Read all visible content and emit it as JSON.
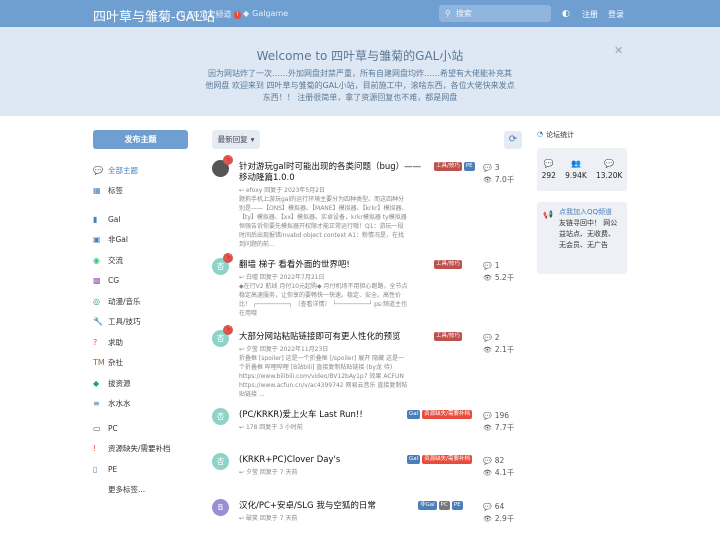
{
  "header": {
    "brand": "四叶草与雏菊-GAL站",
    "nav_tg": "TG定定频道",
    "nav_tg_badge": "!",
    "nav_galgame": "Galgame",
    "search_placeholder": "搜索",
    "register": "注册",
    "login": "登录"
  },
  "hero": {
    "title": "Welcome to 四叶草与雏菊的GAL小站",
    "text": "因为网站炸了一次……外加网盘封禁严重，所有自建网盘均炸……希望有大佬能补充其他网盘 欢迎来到 四叶草与雏菊的GAL小站，目前施工中，滚啥东西，各位大佬快来发点东西！！ 注册很简单，拿了资源回复也不难，都是网盘"
  },
  "sidebar": {
    "post_button": "发布主题",
    "items": [
      {
        "label": "全部主题",
        "icon": "💬",
        "color": "#4a7fb9"
      },
      {
        "label": "标签",
        "icon": "▦",
        "color": "#4a7fb9"
      },
      {
        "label": "Gal",
        "icon": "▮",
        "color": "#4a7fb9"
      },
      {
        "label": "非Gal",
        "icon": "▣",
        "color": "#4a7fb9"
      },
      {
        "label": "交流",
        "icon": "◉",
        "color": "#2ecc71"
      },
      {
        "label": "CG",
        "icon": "▩",
        "color": "#9b59b6"
      },
      {
        "label": "动漫/音乐",
        "icon": "◎",
        "color": "#16a085"
      },
      {
        "label": "工具/技巧",
        "icon": "🔧",
        "color": "#e74c3c"
      },
      {
        "label": "求助",
        "icon": "?",
        "color": "#e74c3c"
      },
      {
        "label": "杂社",
        "icon": "TM",
        "color": "#8a6d3b"
      },
      {
        "label": "拔资源",
        "icon": "◆",
        "color": "#16a085"
      },
      {
        "label": "水水水",
        "icon": "≡",
        "color": "#4a7fb9"
      },
      {
        "label": "PC",
        "icon": "▭",
        "color": "#555"
      },
      {
        "label": "资源缺失/需要补档",
        "icon": "!",
        "color": "#e74c3c"
      },
      {
        "label": "PE",
        "icon": "▯",
        "color": "#4a7fb9"
      },
      {
        "label": "更多标签...",
        "icon": "",
        "color": "#555"
      }
    ]
  },
  "main": {
    "sort_label": "最新回复",
    "topics": [
      {
        "title": "针对游玩gal时可能出现的各类问题（bug）——移动隆篇1.0.0",
        "meta": "efoxy 回复于 2023年5月2日",
        "excerpt": "题莉手机上游玩gal的运行环境主要分为四种类型。而这四种分别是——【ONS】模拟器、【MANE】模拟器、【krkr】模拟器、【ty】模拟器、【xx】模拟器。实卓设备，krkr模拟器 ty模拟器 恒强告诉你要先模拟器开权限才能正常运行哦！Q1：游玩一段时间后出现报错invabd object context A1：粉情况是，在找到问题的前...",
        "avatar": "",
        "avatar_color": "#555",
        "pinned": true,
        "tags": [
          {
            "label": "工具/技巧",
            "color": "#c0504d"
          },
          {
            "label": "PE",
            "color": "#4a7fb9"
          }
        ],
        "replies": "3",
        "views": "7.0千"
      },
      {
        "title": "翻墙 梯子 看看外面的世界吧!",
        "meta": "白嘘 回复于 2022年7月21日",
        "excerpt": "◆在行V2 航线 月付10元起购◆ 月付机场不用担心跑路，全节点稳定高速服务，让你享的要畅快一快速。稳定、安全。高性价比！ ┌─────────┐ 〔查看详情〕 └─────────┘ ps:频道主也在用哦",
        "avatar": "杏",
        "avatar_color": "#8dd3c7",
        "pinned": true,
        "tags": [
          {
            "label": "工具/技巧",
            "color": "#c0504d"
          }
        ],
        "replies": "1",
        "views": "5.2千"
      },
      {
        "title": "大部分网站粘贴链接即可有更人性化的预览",
        "meta": "夕莹 回复于 2022年11月23日",
        "excerpt": "折叠框 [spoiler] 这是一个折叠框 [/spoiler] 展开 隐藏 这是一个折叠框 哔哩哔哩 [B站bili] 直接复制粘贴链接 (by龙 待) https://www.bilibili.com/video/BV12bAy1p7 效果 ACFUN https://www.acfun.cn/v/ac4399742 网易云音乐 直接复制粘贴链接 ...",
        "avatar": "杏",
        "avatar_color": "#8dd3c7",
        "pinned": true,
        "tags": [
          {
            "label": "工具/技巧",
            "color": "#c0504d"
          }
        ],
        "replies": "2",
        "views": "2.1千"
      },
      {
        "title": "(PC/KRKR)爱上火车 Last Run!!",
        "meta": "178 回复于 3 小时前",
        "excerpt": "",
        "avatar": "杏",
        "avatar_color": "#8dd3c7",
        "pinned": false,
        "tags": [
          {
            "label": "Gal",
            "color": "#4a7fb9"
          },
          {
            "label": "资源缺失/需要补档",
            "color": "#e74c3c"
          }
        ],
        "replies": "196",
        "views": "7.7千"
      },
      {
        "title": "(KRKR+PC)Clover Day's",
        "meta": "夕莹 回复于 7 天前",
        "excerpt": "",
        "avatar": "杏",
        "avatar_color": "#8dd3c7",
        "pinned": false,
        "tags": [
          {
            "label": "Gal",
            "color": "#4a7fb9"
          },
          {
            "label": "资源缺失/需要补档",
            "color": "#e74c3c"
          }
        ],
        "replies": "82",
        "views": "4.1千"
      },
      {
        "title": "汉化/PC+安卓/SLG 我与空狐的日常",
        "meta": "破笑 回复于 7 天前",
        "excerpt": "",
        "avatar": "B",
        "avatar_color": "#9b8fd3",
        "pinned": false,
        "tags": [
          {
            "label": "非Gal",
            "color": "#4a7fb9"
          },
          {
            "label": "PC",
            "color": "#777"
          },
          {
            "label": "PE",
            "color": "#4a7fb9"
          }
        ],
        "replies": "64",
        "views": "2.9千"
      }
    ]
  },
  "right": {
    "stats_title": "论坛统计",
    "stats": [
      {
        "icon": "💬",
        "value": "292"
      },
      {
        "icon": "👥",
        "value": "9.94K"
      },
      {
        "icon": "💬",
        "value": "13.20K"
      }
    ],
    "qq_link": "点我加入QQ频道",
    "qq_text": "友链寻回中！ 网公益站点、无收费、无会员、无广告"
  }
}
